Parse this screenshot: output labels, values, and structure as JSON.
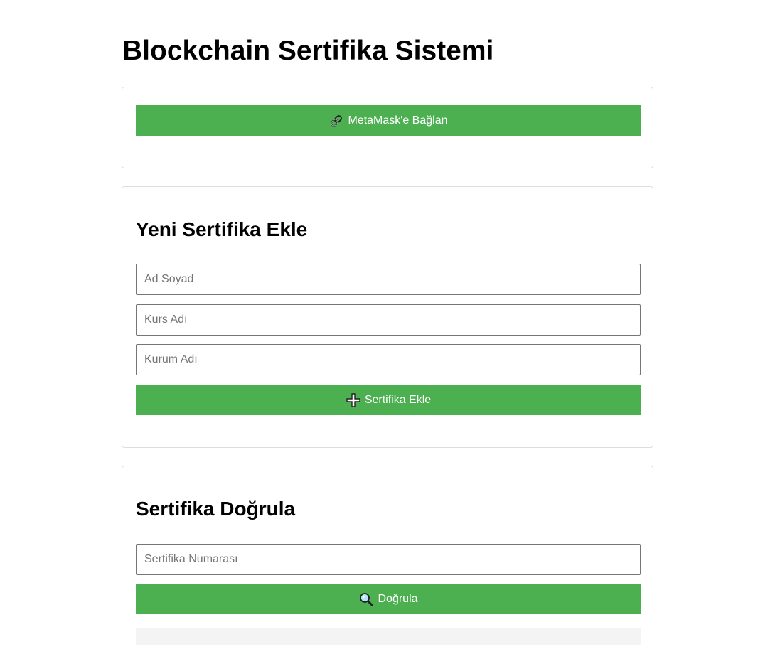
{
  "header": {
    "title": "Blockchain Sertifika Sistemi"
  },
  "connect": {
    "button_label": "MetaMask'e Bağlan",
    "button_icon": "link-icon"
  },
  "add_certificate": {
    "title": "Yeni Sertifika Ekle",
    "fields": {
      "name_placeholder": "Ad Soyad",
      "course_placeholder": "Kurs Adı",
      "institution_placeholder": "Kurum Adı"
    },
    "button_label": "Sertifika Ekle",
    "button_icon": "plus-icon"
  },
  "verify_certificate": {
    "title": "Sertifika Doğrula",
    "fields": {
      "certificate_number_placeholder": "Sertifika Numarası"
    },
    "button_label": "Doğrula",
    "button_icon": "magnifier-icon"
  },
  "colors": {
    "button_background": "#4caf50",
    "button_text": "#ffffff",
    "card_border": "#dddddd",
    "result_background": "#f4f4f4"
  }
}
